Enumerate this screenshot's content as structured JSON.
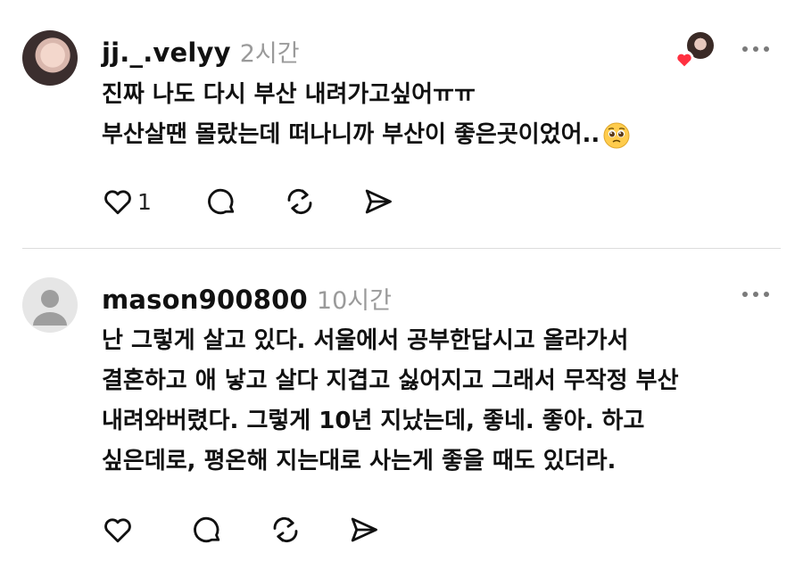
{
  "comments": [
    {
      "handle": "jj._.velyy",
      "time": "2시간",
      "lines": [
        "진짜 나도 다시 부산 내려가고싶어ㅠㅠ",
        "부산살땐 몰랐는데 떠나니까 부산이 좋은곳이었어.."
      ],
      "emoji": "pleading-face-emoji",
      "like_count": "1",
      "liked_by_author": true
    },
    {
      "handle": "mason900800",
      "time": "10시간",
      "lines": [
        "난 그렇게 살고 있다. 서울에서 공부한답시고 올라가서",
        "결혼하고 애 낳고 살다 지겹고 싫어지고 그래서 무작정 부산",
        "내려와버렸다. 그렇게 10년 지났는데, 좋네. 좋아. 하고",
        "싶은데로, 평온해 지는대로 사는게 좋을 때도 있더라."
      ],
      "like_count": ""
    }
  ],
  "icons": [
    "heart-icon",
    "comment-icon",
    "repost-icon",
    "share-icon",
    "more-icon"
  ],
  "colors": {
    "text": "#111111",
    "muted": "#9a9a9a",
    "heart_red": "#ff3040",
    "divider": "#dddddd"
  }
}
